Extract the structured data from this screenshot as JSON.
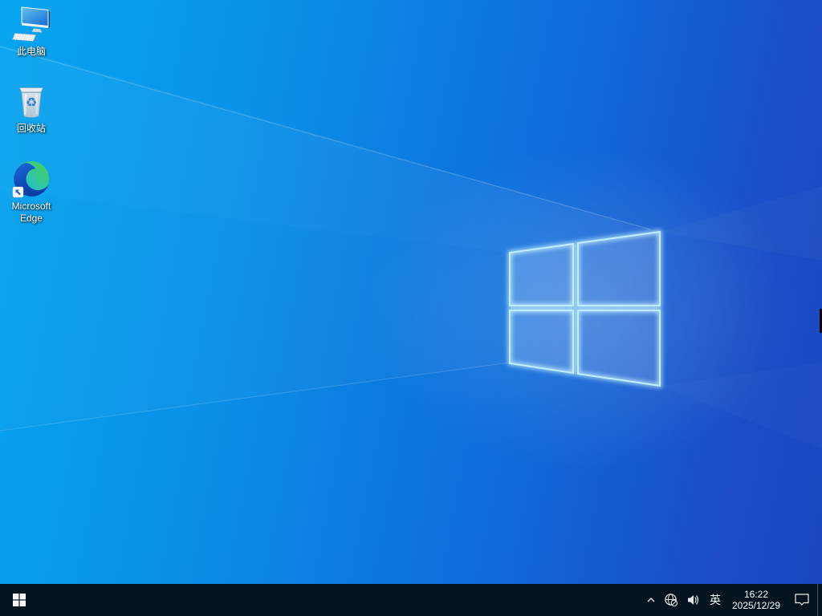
{
  "desktop": {
    "wallpaper": "windows-10-light-blue-logo",
    "icons": [
      {
        "id": "this-pc",
        "label": "此电脑"
      },
      {
        "id": "recycle-bin",
        "label": "回收站"
      },
      {
        "id": "microsoft-edge",
        "label": "Microsoft Edge",
        "label_line1": "Microsoft",
        "label_line2": "Edge"
      }
    ]
  },
  "taskbar": {
    "start_icon": "windows-start-icon",
    "tray": {
      "hidden_icons_icon": "chevron-up-icon",
      "network_icon": "globe-no-internet-icon",
      "volume_icon": "speaker-icon",
      "language_indicator": "英",
      "clock": {
        "time": "16:22",
        "date": "2025/12/29"
      },
      "action_center_icon": "action-center-bubble-icon"
    }
  },
  "colors": {
    "wallpaper_left": "#07a5f0",
    "wallpaper_right": "#1a46bf",
    "logo_stroke": "#bfeffe",
    "taskbar_bg": "#04141e",
    "taskbar_text": "#ffffff"
  }
}
